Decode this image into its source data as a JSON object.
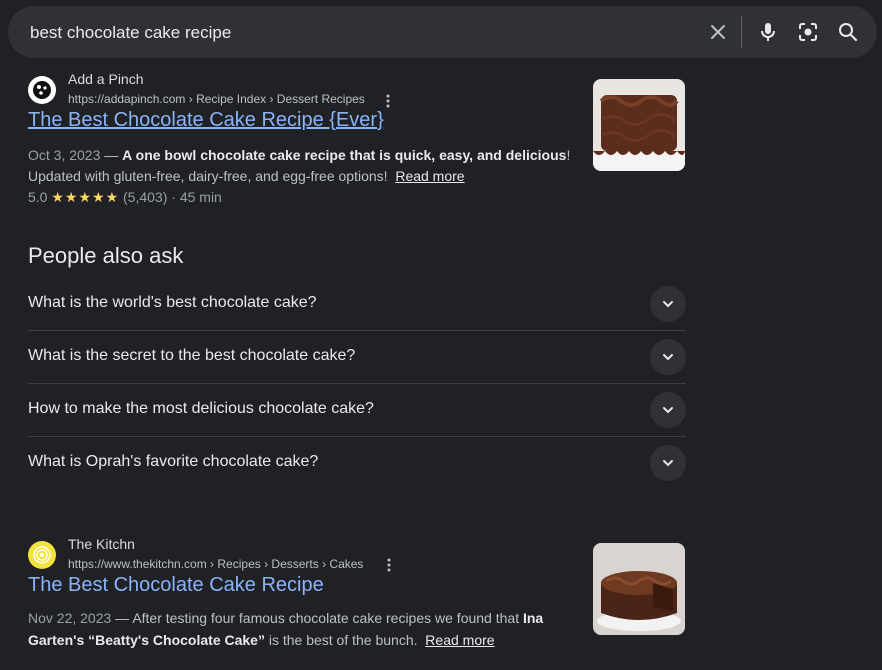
{
  "search": {
    "query": "best chocolate cake recipe"
  },
  "icons": {
    "clear": "close-icon",
    "voice": "microphone-icon",
    "lens": "camera-lens-icon",
    "search": "search-icon",
    "more": "more-vert-icon",
    "expand": "chevron-down-icon"
  },
  "results": [
    {
      "site_name": "Add a Pinch",
      "url": "https://addapinch.com › Recipe Index › Dessert Recipes",
      "title": "The Best Chocolate Cake Recipe {Ever}",
      "date": "Oct 3, 2023",
      "sep": " — ",
      "snippet_bold": "A one bowl chocolate cake recipe that is quick, easy, and delicious",
      "snippet_bang": "!",
      "snippet_line2": "Updated with gluten-free, dairy-free, and egg-free options!",
      "read_more": "Read more",
      "rating": "5.0",
      "stars": "★★★★★",
      "reviews": "(5,403)",
      "time": "· 45 min"
    },
    {
      "site_name": "The Kitchn",
      "url": "https://www.thekitchn.com › Recipes › Desserts › Cakes",
      "title": "The Best Chocolate Cake Recipe",
      "date": "Nov 22, 2023",
      "sep": " — ",
      "snippet_a": "After testing four famous chocolate cake recipes we found that ",
      "snippet_bold_a": "Ina",
      "snippet_bold_b": "Garten's “Beatty's Chocolate Cake”",
      "snippet_b": " is the best of the bunch.",
      "read_more": "Read more"
    }
  ],
  "people_also_ask": {
    "title": "People also ask",
    "questions": [
      "What is the world's best chocolate cake?",
      "What is the secret to the best chocolate cake?",
      "How to make the most delicious chocolate cake?",
      "What is Oprah's favorite chocolate cake?"
    ]
  },
  "colors": {
    "background": "#202124",
    "searchbar": "#303134",
    "link": "#8ab4f8",
    "star": "#fdd663"
  }
}
